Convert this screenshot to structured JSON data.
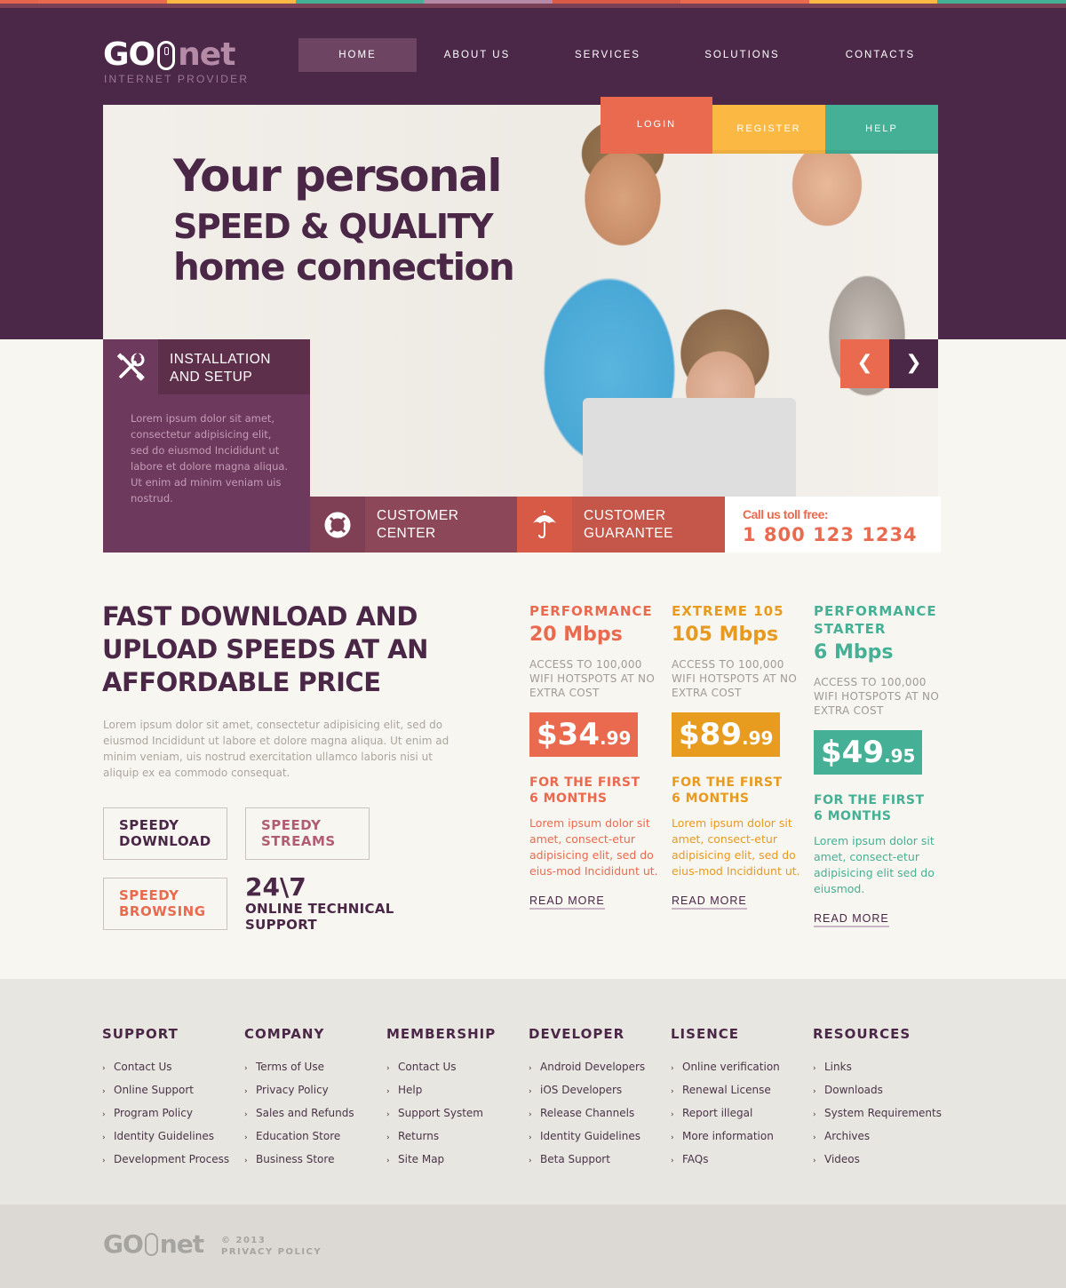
{
  "colors": {
    "purple": "#4c2848",
    "coral": "#e96a4f",
    "yellow": "#fbb944",
    "teal": "#45b095",
    "mauve": "#b48aa6",
    "orange": "#e89c1f"
  },
  "top_strip": [
    "#e4644e",
    "#e96a4f",
    "#fbb944",
    "#45b095",
    "#b48aa6",
    "#d65a45",
    "#e96a4f",
    "#fbb944",
    "#45b095"
  ],
  "logo": {
    "part1": "GO",
    "part2": "net",
    "tagline": "INTERNET PROVIDER",
    "icon": "computer-mouse-icon"
  },
  "nav": {
    "items": [
      {
        "label": "HOME",
        "active": true
      },
      {
        "label": "ABOUT US",
        "active": false
      },
      {
        "label": "SERVICES",
        "active": false
      },
      {
        "label": "SOLUTIONS",
        "active": false
      },
      {
        "label": "CONTACTS",
        "active": false
      }
    ]
  },
  "auth": {
    "login": "LOGIN",
    "register": "REGISTER",
    "help": "HELP"
  },
  "hero": {
    "line1": "Your personal",
    "line2": "SPEED & QUALITY",
    "line3": "home connection",
    "image": "family-with-laptop-photo",
    "prev": "❮",
    "next": "❯"
  },
  "installation": {
    "title_line1": "INSTALLATION",
    "title_line2": "AND SETUP",
    "icon": "tools-icon",
    "text": "Lorem ipsum dolor sit amet, consectetur adipisicing elit, sed do eiusmod Incididunt ut labore et dolore magna aliqua. Ut enim ad minim veniam uis nostrud."
  },
  "customer_center": {
    "line1": "CUSTOMER",
    "line2": "CENTER",
    "icon": "lifebuoy-icon"
  },
  "customer_guarantee": {
    "line1": "CUSTOMER",
    "line2": "GUARANTEE",
    "icon": "umbrella-icon"
  },
  "toll_free": {
    "label": "Call us toll free:",
    "number": "1 800 123 1234"
  },
  "features": {
    "title": "FAST DOWNLOAD AND UPLOAD SPEEDS AT AN AFFORDABLE PRICE",
    "text": "Lorem ipsum dolor sit amet, consectetur adipisicing elit, sed do eiusmod Incididunt ut labore et dolore magna aliqua. Ut enim ad minim veniam, uis nostrud exercitation ullamco laboris nisi ut aliquip ex ea commodo consequat.",
    "boxes": [
      {
        "line1": "SPEEDY",
        "line2": "DOWNLOAD"
      },
      {
        "line1": "SPEEDY",
        "line2": "STREAMS"
      },
      {
        "line1": "SPEEDY",
        "line2": "BROWSING"
      }
    ],
    "support_big": "24\\7",
    "support_line1": "ONLINE TECHNICAL",
    "support_line2": "SUPPORT"
  },
  "plans": [
    {
      "name_line1": "PERFORMANCE",
      "name_line2": "",
      "speed": "20 Mbps",
      "desc": "ACCESS TO 100,000 WIFI HOTSPOTS AT NO EXTRA COST",
      "price_dollars": "$34",
      "price_cents": ".99",
      "for_line1": "FOR THE FIRST",
      "for_line2": "6 MONTHS",
      "text": "Lorem ipsum dolor sit amet, consect-etur adipisicing elit, sed do eius-mod Incididunt ut.",
      "read_more": "READ MORE"
    },
    {
      "name_line1": "EXTREME 105",
      "name_line2": "",
      "speed": "105 Mbps",
      "desc": "ACCESS TO 100,000 WIFI HOTSPOTS AT NO EXTRA COST",
      "price_dollars": "$89",
      "price_cents": ".99",
      "for_line1": "FOR THE FIRST",
      "for_line2": "6 MONTHS",
      "text": "Lorem ipsum dolor sit amet, consect-etur adipisicing elit, sed do eius-mod Incididunt ut.",
      "read_more": "READ MORE"
    },
    {
      "name_line1": "PERFORMANCE",
      "name_line2": "STARTER",
      "speed": "6 Mbps",
      "desc": "ACCESS TO 100,000 WIFI HOTSPOTS AT NO EXTRA COST",
      "price_dollars": "$49",
      "price_cents": ".95",
      "for_line1": "FOR THE FIRST",
      "for_line2": "6 MONTHS",
      "text": "Lorem ipsum dolor sit amet, consect-etur adipisicing elit sed do eiusmod.",
      "read_more": "READ MORE"
    }
  ],
  "footer": {
    "columns": [
      {
        "heading": "SUPPORT",
        "links": [
          "Contact Us",
          "Online Support",
          "Program Policy",
          "Identity Guidelines",
          "Development Process"
        ]
      },
      {
        "heading": "COMPANY",
        "links": [
          "Terms of Use",
          "Privacy Policy",
          "Sales and Refunds",
          "Education Store",
          "Business Store"
        ]
      },
      {
        "heading": "MEMBERSHIP",
        "links": [
          "Contact Us",
          "Help",
          "Support System",
          "Returns",
          "Site Map"
        ]
      },
      {
        "heading": "DEVELOPER",
        "links": [
          "Android Developers",
          "iOS Developers",
          "Release Channels",
          "Identity Guidelines",
          "Beta Support"
        ]
      },
      {
        "heading": "LISENCE",
        "links": [
          "Online verification",
          "Renewal License",
          "Report illegal",
          "More information",
          "FAQs"
        ]
      },
      {
        "heading": "RESOURCES",
        "links": [
          "Links",
          "Downloads",
          "System Requirements",
          "Archives",
          "Videos"
        ]
      }
    ],
    "chevron": "›"
  },
  "bottom": {
    "logo_part1": "GO",
    "logo_part2": "net",
    "copyright": "© 2013",
    "privacy": "PRIVACY POLICY"
  }
}
